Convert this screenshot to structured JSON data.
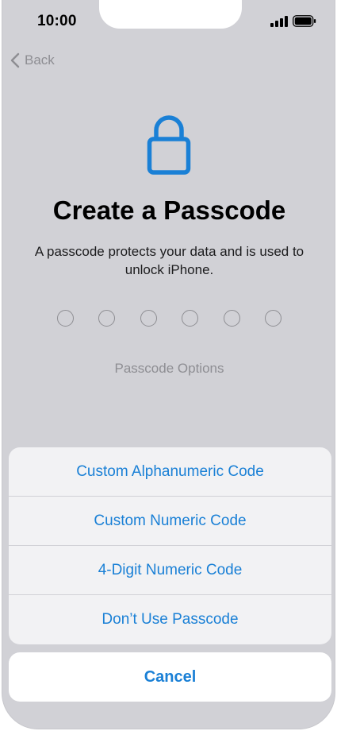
{
  "status_bar": {
    "time": "10:00",
    "signal_icon": "cellular-signal-icon",
    "battery_icon": "battery-icon"
  },
  "nav": {
    "back_label": "Back",
    "back_icon": "chevron-left-icon"
  },
  "header": {
    "icon": "lock-icon",
    "title": "Create a Passcode",
    "subtitle": "A passcode protects your data and is used to unlock iPhone."
  },
  "passcode": {
    "digits_entered": 0,
    "digit_count": 6
  },
  "options_link": "Passcode Options",
  "action_sheet": {
    "items": [
      {
        "label": "Custom Alphanumeric Code"
      },
      {
        "label": "Custom Numeric Code"
      },
      {
        "label": "4-Digit Numeric Code"
      },
      {
        "label": "Don’t Use Passcode"
      }
    ],
    "cancel_label": "Cancel"
  },
  "colors": {
    "accent": "#1a80d6",
    "dim_background": "#d1d1d6",
    "secondary_text": "#8e8e93"
  }
}
